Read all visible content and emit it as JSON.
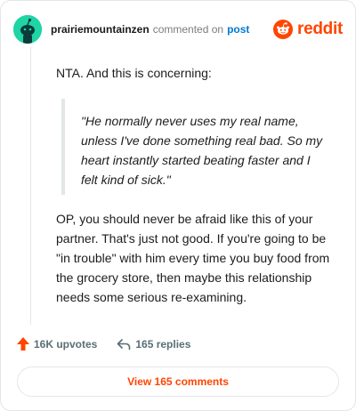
{
  "header": {
    "username": "prairiemountainzen",
    "commented_text": "commented on",
    "post_link": "post",
    "brand": "reddit"
  },
  "comment": {
    "intro": "NTA. And this is concerning:",
    "quote": "\"He normally never uses my real name, unless I've done something real bad. So my heart instantly started beating faster and I felt kind of sick.\"",
    "body": "OP, you should never be afraid like this of your partner. That's just not good. If you're going to be \"in trouble\" with him every time you buy food from the grocery store, then maybe this relationship needs some serious re-examining."
  },
  "actions": {
    "upvotes": "16K upvotes",
    "replies": "165 replies"
  },
  "view_comments": "View 165 comments",
  "colors": {
    "brand": "#ff4500",
    "link": "#0079d3",
    "avatar": "#1fd4a5"
  },
  "icons": {
    "avatar": "snoo-avatar-icon",
    "logo": "reddit-logo-icon",
    "upvote": "upvote-arrow-icon",
    "reply": "reply-arrow-icon"
  }
}
